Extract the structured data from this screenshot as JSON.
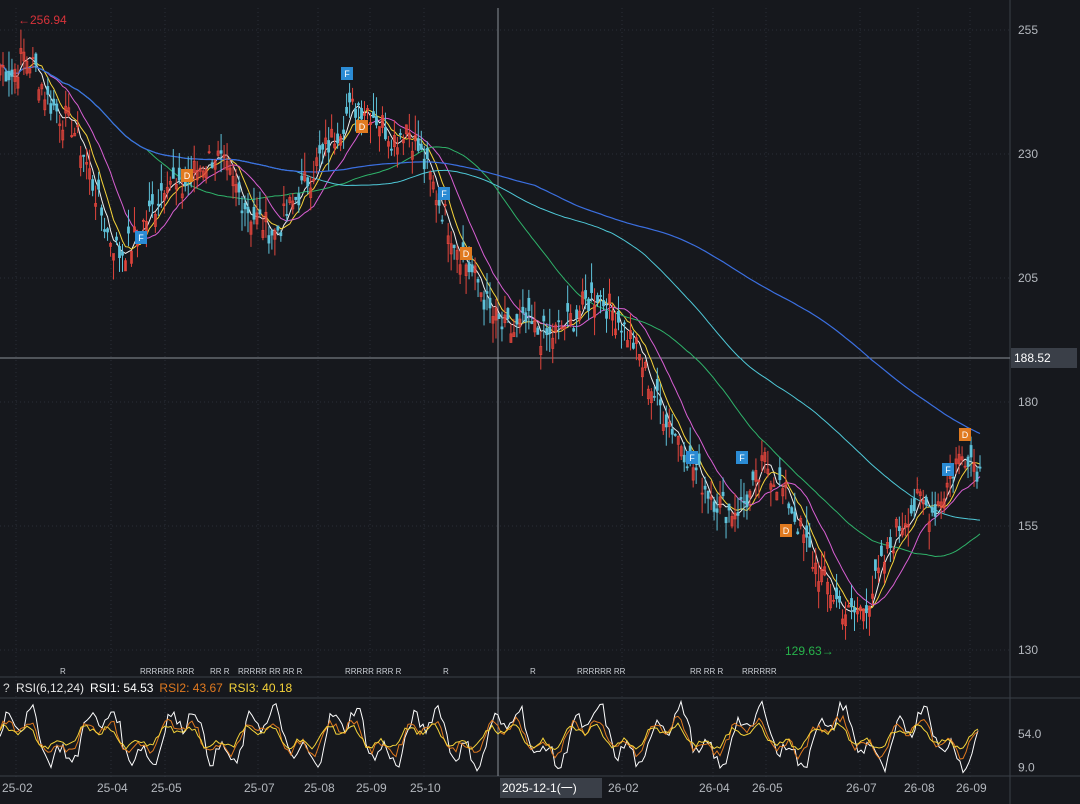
{
  "chart_data": [
    {
      "type": "candlestick",
      "price_axis": {
        "ticks": [
          "255",
          "230",
          "205",
          "180",
          "155",
          "130"
        ],
        "tick_values": [
          255,
          230,
          205,
          180,
          155,
          130
        ]
      },
      "date_axis": {
        "labels": [
          "25-02",
          "25-04",
          "25-05",
          "25-07",
          "25-08",
          "25-09",
          "25-10",
          "26-02",
          "26-04",
          "26-05",
          "26-07",
          "26-08",
          "26-09"
        ]
      },
      "annotations": {
        "high_label": "256.94",
        "low_label": "129.63",
        "crosshair_price": "188.52",
        "crosshair_date": "2025-12-1(一)"
      },
      "close_series": [
        248,
        246,
        250,
        247,
        241,
        238,
        236,
        230,
        222,
        214,
        210,
        212,
        216,
        220,
        226,
        222,
        226,
        228,
        230,
        226,
        222,
        218,
        216,
        214,
        218,
        222,
        226,
        230,
        234,
        238,
        240,
        239,
        236,
        233,
        236,
        231,
        225,
        219,
        213,
        208,
        204,
        198,
        195,
        194,
        196,
        194,
        193,
        195,
        197,
        200,
        202,
        199,
        196,
        192,
        186,
        180,
        176,
        172,
        167,
        163,
        160,
        158,
        159,
        162,
        168,
        164,
        160,
        154,
        148,
        144,
        140,
        137,
        138,
        142,
        148,
        154,
        158,
        160,
        158,
        162,
        168,
        170,
        166
      ],
      "markers": [
        {
          "label": "F",
          "kind": "F"
        },
        {
          "label": "D",
          "kind": "D"
        },
        {
          "label": "F",
          "kind": "F"
        },
        {
          "label": "D",
          "kind": "D"
        },
        {
          "label": "F",
          "kind": "F"
        },
        {
          "label": "D",
          "kind": "D"
        },
        {
          "label": "F",
          "kind": "F"
        },
        {
          "label": "F",
          "kind": "F"
        },
        {
          "label": "D",
          "kind": "D"
        },
        {
          "label": "F",
          "kind": "F"
        },
        {
          "label": "D",
          "kind": "D"
        }
      ],
      "r_markers": [
        "R",
        "RRRRRR RRR",
        "RR R",
        "RRRRR RR RR R",
        "RRRRR RRR R",
        "R",
        "R",
        "RRRRRR RR",
        "RR RR R",
        "RRRRRR"
      ],
      "colors": {
        "up": "#e2453c",
        "down": "#5ec1d9",
        "ma5": "#f2f2f2",
        "ma10": "#f5d33a",
        "ma20": "#d85fd3",
        "ma60": "#2fb36a",
        "ma120": "#4fc9d8",
        "ma250": "#3b6fe0",
        "marker_f": "#2b8bd4",
        "marker_d": "#e07a20",
        "high_label": "#d8333a",
        "low_label": "#27b34b"
      }
    },
    {
      "type": "line",
      "name": "RSI",
      "legend": {
        "title": "RSI(6,12,24)",
        "rsi1": "RSI1: 54.53",
        "rsi2": "RSI2: 43.67",
        "rsi3": "RSI3: 40.18"
      },
      "y_ticks": [
        "54.0",
        "9.0"
      ],
      "y_tick_values": [
        54,
        9
      ],
      "series": [
        {
          "name": "RSI1",
          "color": "#ffffff"
        },
        {
          "name": "RSI2",
          "color": "#e07a20"
        },
        {
          "name": "RSI3",
          "color": "#f5d33a"
        }
      ]
    }
  ],
  "ui": {
    "help_label": "?"
  }
}
